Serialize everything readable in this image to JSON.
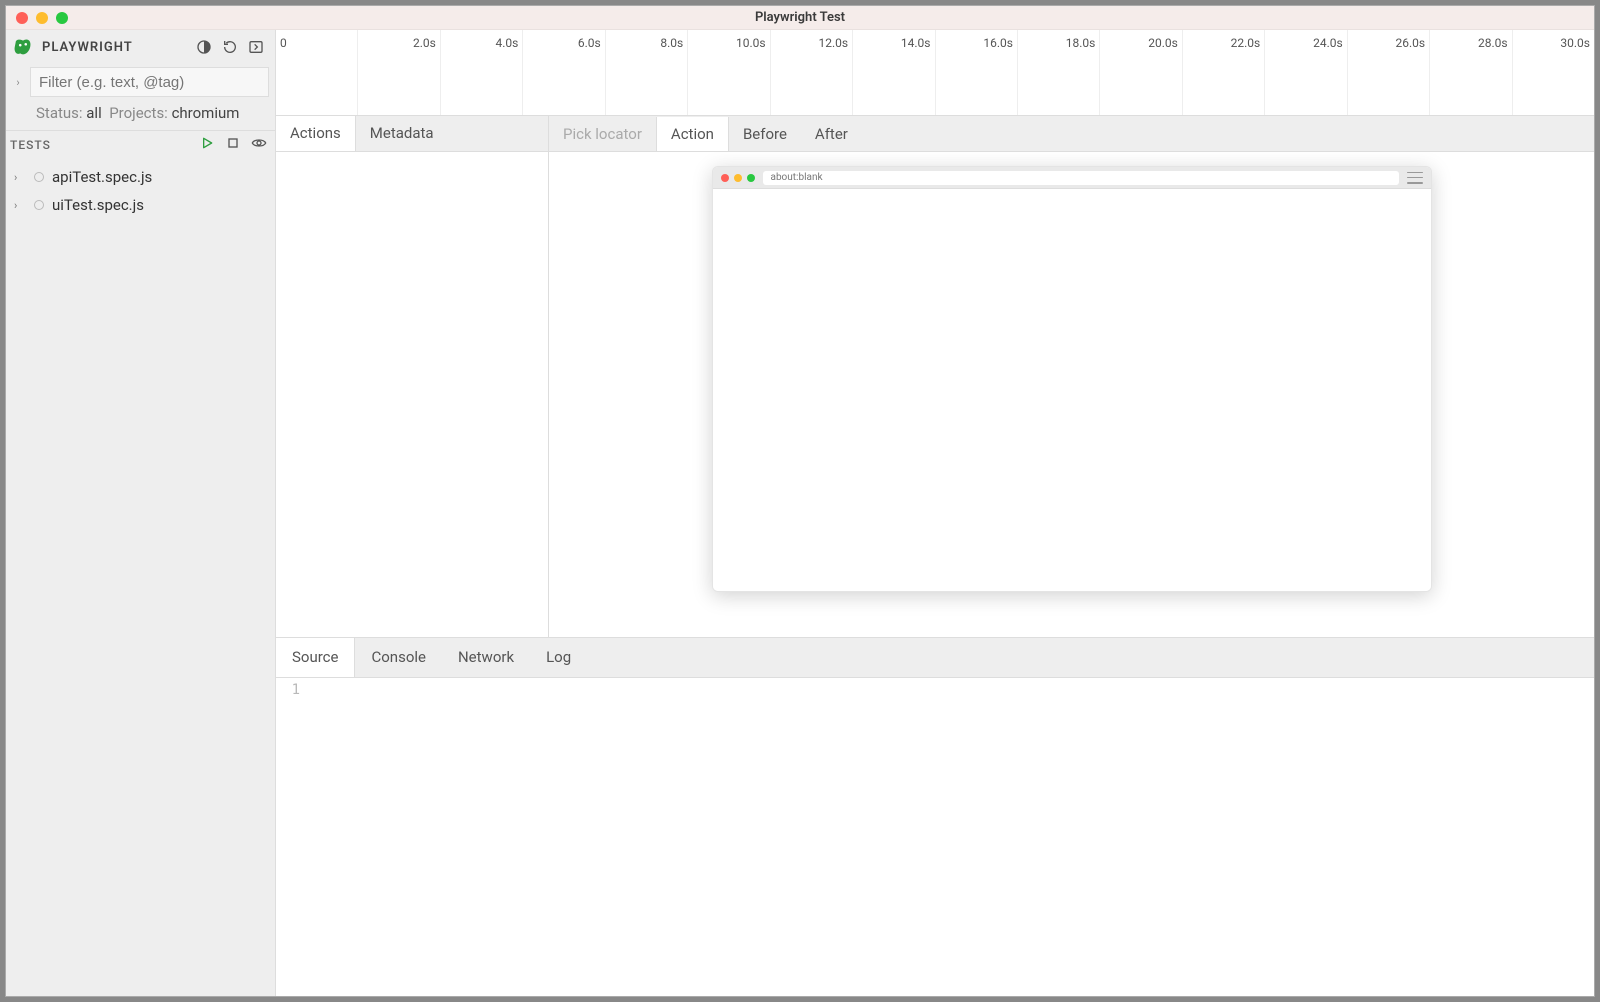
{
  "window_title": "Playwright Test",
  "sidebar": {
    "title": "PLAYWRIGHT",
    "filter_placeholder": "Filter (e.g. text, @tag)",
    "status_label": "Status:",
    "status_value": "all",
    "projects_label": "Projects:",
    "projects_value": "chromium",
    "tests_label": "TESTS",
    "tests": [
      {
        "name": "apiTest.spec.js"
      },
      {
        "name": "uiTest.spec.js"
      }
    ]
  },
  "timeline": {
    "ticks": [
      "0",
      "2.0s",
      "4.0s",
      "6.0s",
      "8.0s",
      "10.0s",
      "12.0s",
      "14.0s",
      "16.0s",
      "18.0s",
      "20.0s",
      "22.0s",
      "24.0s",
      "26.0s",
      "28.0s",
      "30.0s"
    ]
  },
  "actions_tabs": [
    "Actions",
    "Metadata"
  ],
  "preview": {
    "pick_locator": "Pick locator",
    "tabs": [
      "Action",
      "Before",
      "After"
    ],
    "browser_url": "about:blank"
  },
  "bottom_tabs": [
    "Source",
    "Console",
    "Network",
    "Log"
  ],
  "source_gutter": "1"
}
